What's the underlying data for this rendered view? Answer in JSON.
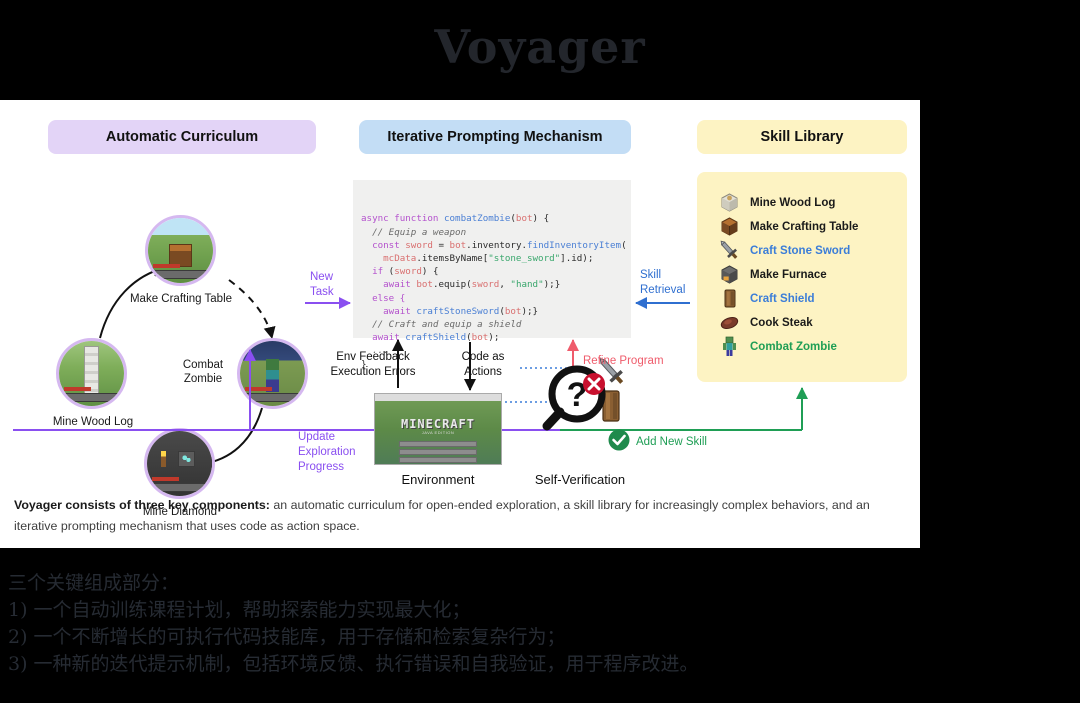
{
  "title": "Voyager",
  "columns": {
    "curriculum": "Automatic Curriculum",
    "prompting": "Iterative Prompting Mechanism",
    "skill_library": "Skill Library"
  },
  "curriculum_nodes": [
    {
      "label": "Make Crafting Table",
      "icon": "crafting-table-scene"
    },
    {
      "label": "Mine Wood Log",
      "icon": "wood-log-scene"
    },
    {
      "label": "Combat\nZombie",
      "icon": "zombie-scene"
    },
    {
      "label": "Mine Diamond",
      "icon": "diamond-ore-scene"
    }
  ],
  "code": {
    "lines": [
      [
        {
          "t": "async function ",
          "c": "kw"
        },
        {
          "t": "combatZombie",
          "c": "fn"
        },
        {
          "t": "(",
          "c": "pl"
        },
        {
          "t": "bot",
          "c": "var"
        },
        {
          "t": ") {",
          "c": "pl"
        }
      ],
      [
        {
          "t": "  // Equip a weapon",
          "c": "com"
        }
      ],
      [
        {
          "t": "  const ",
          "c": "kw"
        },
        {
          "t": "sword",
          "c": "var"
        },
        {
          "t": " = ",
          "c": "pl"
        },
        {
          "t": "bot",
          "c": "var"
        },
        {
          "t": ".inventory.",
          "c": "pl"
        },
        {
          "t": "findInventoryItem",
          "c": "fn"
        },
        {
          "t": "(",
          "c": "pl"
        }
      ],
      [
        {
          "t": "    mcData",
          "c": "var"
        },
        {
          "t": ".itemsByName[",
          "c": "pl"
        },
        {
          "t": "\"stone_sword\"",
          "c": "str"
        },
        {
          "t": "].id);",
          "c": "pl"
        }
      ],
      [
        {
          "t": "  if ",
          "c": "kw"
        },
        {
          "t": "(",
          "c": "pl"
        },
        {
          "t": "sword",
          "c": "var"
        },
        {
          "t": ") {",
          "c": "pl"
        }
      ],
      [
        {
          "t": "    await ",
          "c": "kw"
        },
        {
          "t": "bot",
          "c": "var"
        },
        {
          "t": ".equip(",
          "c": "pl"
        },
        {
          "t": "sword",
          "c": "var"
        },
        {
          "t": ", ",
          "c": "pl"
        },
        {
          "t": "\"hand\"",
          "c": "str"
        },
        {
          "t": ");}",
          "c": "pl"
        }
      ],
      [
        {
          "t": "  else {",
          "c": "kw"
        }
      ],
      [
        {
          "t": "    await ",
          "c": "kw"
        },
        {
          "t": "craftStoneSword",
          "c": "fn"
        },
        {
          "t": "(",
          "c": "pl"
        },
        {
          "t": "bot",
          "c": "var"
        },
        {
          "t": ");}",
          "c": "pl"
        }
      ],
      [
        {
          "t": "  // Craft and equip a shield",
          "c": "com"
        }
      ],
      [
        {
          "t": "  await ",
          "c": "kw"
        },
        {
          "t": "craftShield",
          "c": "fn"
        },
        {
          "t": "(",
          "c": "pl"
        },
        {
          "t": "bot",
          "c": "var"
        },
        {
          "t": ");",
          "c": "pl"
        }
      ],
      [
        {
          "t": "  ...",
          "c": "com"
        }
      ],
      [
        {
          "t": "}",
          "c": "pl"
        }
      ]
    ]
  },
  "flow_labels": {
    "new_task": "New\nTask",
    "skill_retrieval": "Skill\nRetrieval",
    "env_feedback": "Env Feedback\nExecution Errors",
    "code_as_actions": "Code as\nActions",
    "refine_program": "Refine Program",
    "update_exploration": "Update\nExploration\nProgress",
    "add_new_skill": "Add New Skill"
  },
  "bottom_labels": {
    "environment": "Environment",
    "self_verification": "Self-Verification"
  },
  "skills": [
    {
      "label": "Mine Wood  Log",
      "color": "black",
      "icon": "wood-log-icon"
    },
    {
      "label": "Make Crafting Table",
      "color": "black",
      "icon": "crafting-table-icon"
    },
    {
      "label": "Craft Stone Sword",
      "color": "blue",
      "icon": "stone-sword-icon"
    },
    {
      "label": "Make Furnace",
      "color": "black",
      "icon": "furnace-icon"
    },
    {
      "label": "Craft Shield",
      "color": "blue",
      "icon": "shield-icon"
    },
    {
      "label": "Cook Steak",
      "color": "black",
      "icon": "steak-icon"
    },
    {
      "label": "Combat Zombie",
      "color": "green",
      "icon": "zombie-icon"
    }
  ],
  "caption": {
    "lead": "Voyager consists of three key components:",
    "rest": " an automatic curriculum for open-ended exploration, a skill library for increasingly complex behaviors, and an iterative prompting mechanism that uses code as action space."
  },
  "chinese": {
    "heading": "三个关键组成部分：",
    "items": [
      "1) 一个自动训练课程计划，帮助探索能力实现最大化；",
      "2) 一个不断增长的可执行代码技能库，用于存储和检索复杂行为；",
      "3) 一种新的迭代提示机制，包括环境反馈、执行错误和自我验证，用于程序改进。"
    ]
  },
  "colors": {
    "curriculum_header": "#e3d4f7",
    "prompting_header": "#c3ddf5",
    "skill_header": "#fdf3c3",
    "purple_flow": "#8a4ff0",
    "blue_flow": "#2f6fd0",
    "red_flow": "#ef5b6b",
    "green_flow": "#1f9e55",
    "node_ring": "#d5b8f0"
  },
  "env_window": {
    "logo": "MINECRAFT",
    "edition": "JAVA EDITION"
  }
}
